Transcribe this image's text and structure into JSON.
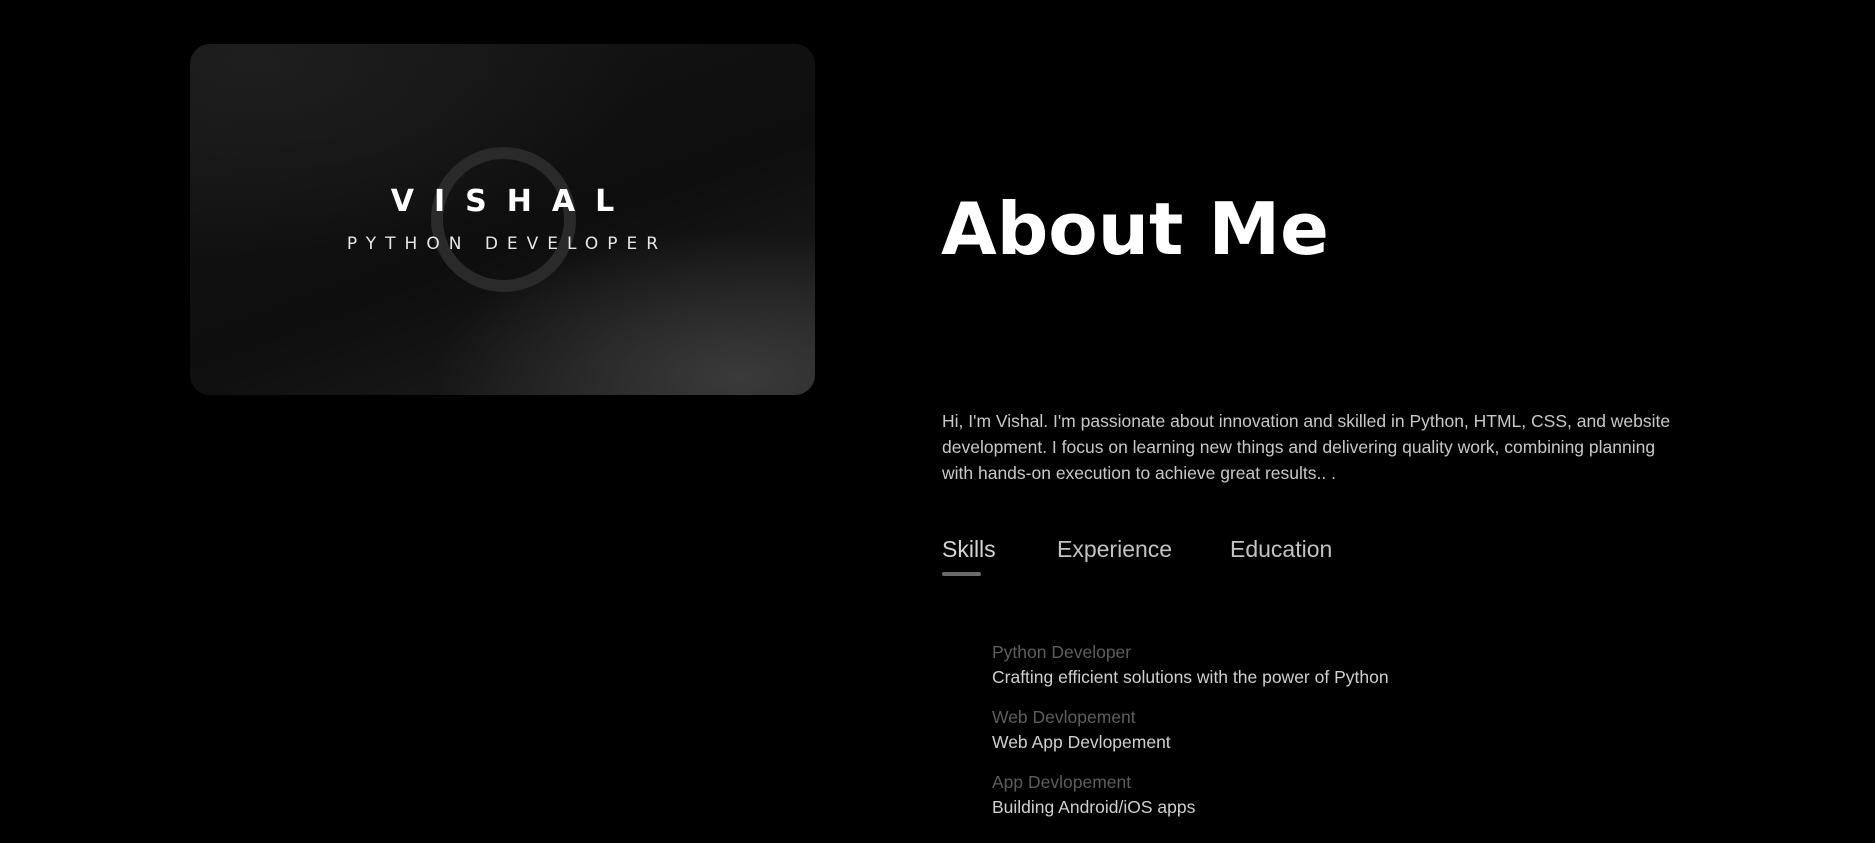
{
  "card": {
    "name": "VISHAL",
    "role": "PYTHON DEVELOPER"
  },
  "about": {
    "title": "About Me",
    "intro": "Hi, I'm Vishal. I'm passionate about innovation and skilled in Python, HTML, CSS, and website development. I focus on learning new things and delivering quality work, combining planning with hands-on execution to achieve great results.. ."
  },
  "tabs": [
    {
      "label": "Skills",
      "active": true
    },
    {
      "label": "Experience",
      "active": false
    },
    {
      "label": "Education",
      "active": false
    }
  ],
  "skills": [
    {
      "title": "Python Developer",
      "description": "Crafting efficient solutions with the power of Python"
    },
    {
      "title": "Web Devlopement",
      "description": "Web App Devlopement"
    },
    {
      "title": "App Devlopement",
      "description": "Building Android/iOS apps"
    }
  ],
  "colors": {
    "background": "#000000",
    "text_primary": "#ffffff",
    "text_muted": "#5d5d5d",
    "tab_underline": "#6b6b6b"
  }
}
